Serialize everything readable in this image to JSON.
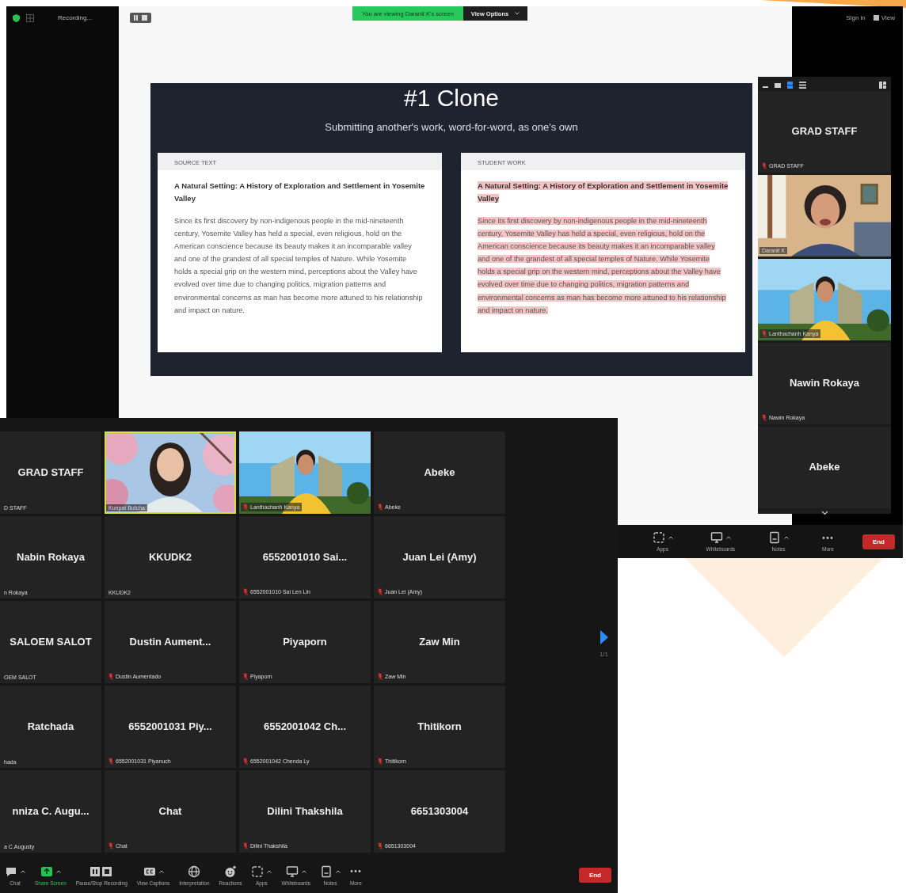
{
  "shared_screen_window": {
    "top_bar": {
      "recording": "Recording...",
      "banner": "You are viewing Daranit K's screen",
      "view_options": "View Options",
      "sign_in": "Sign in",
      "view": "View"
    },
    "slide": {
      "title": "#1 Clone",
      "subtitle": "Submitting another's work, word-for-word, as one's own",
      "panels": [
        {
          "heading": "SOURCE TEXT",
          "title": "A Natural Setting: A History of Exploration and Settlement in Yosemite Valley",
          "body": "Since its first discovery by non-indigenous people in the mid-nineteenth century, Yosemite Valley has held a special, even religious, hold on the American conscience because its beauty makes it an incomparable valley and one of the grandest of all special temples of Nature. While Yosemite holds a special grip on the western mind, perceptions about the Valley have evolved over time due to changing politics, migration patterns and environmental concerns as man has become more attuned to his relationship and impact on nature.",
          "highlighted": false
        },
        {
          "heading": "STUDENT WORK",
          "title": "A Natural Setting: A History of Exploration and Settlement in Yosemite Valley",
          "body": "Since its first discovery by non-indigenous people in the mid-nineteenth century, Yosemite Valley has held a special, even religious, hold on the American conscience because its beauty makes it an incomparable valley and one of the grandest of all special temples of Nature. While Yosemite holds a special grip on the western mind, perceptions about the Valley have evolved over time due to changing politics, migration patterns and environmental concerns as man has become more attuned to his relationship and impact on nature.",
          "highlighted": true
        }
      ]
    },
    "gallery": [
      {
        "kind": "name",
        "name": "GRAD STAFF",
        "label": "GRAD STAFF",
        "muted": true
      },
      {
        "kind": "video",
        "label": "Daranit K",
        "muted": false
      },
      {
        "kind": "video",
        "label": "Lanthachanh Kanya",
        "muted": true
      },
      {
        "kind": "name",
        "name": "Nawin Rokaya",
        "label": "Nawin Rokaya",
        "muted": true
      },
      {
        "kind": "name",
        "name": "Abeke"
      }
    ],
    "toolbar": [
      {
        "kind": "apps",
        "label": "Apps"
      },
      {
        "kind": "whiteboards",
        "label": "Whiteboards"
      },
      {
        "kind": "notes",
        "label": "Notes"
      },
      {
        "kind": "more",
        "label": "More"
      }
    ],
    "end": "End"
  },
  "meeting_window": {
    "tiles": [
      {
        "kind": "name",
        "name": "GRAD STAFF",
        "label": "D STAFF",
        "muted": false,
        "speaking": false
      },
      {
        "kind": "video",
        "label": "Kunpat Butcha",
        "muted": false,
        "speaking": true
      },
      {
        "kind": "video",
        "label": "Lanthachanh Kanya",
        "muted": true,
        "speaking": false
      },
      {
        "kind": "name",
        "name": "Abeke",
        "label": "Abeke",
        "muted": true,
        "speaking": false
      },
      {
        "kind": "name",
        "name": "Nabin Rokaya",
        "label": "n Rokaya",
        "muted": false,
        "speaking": false
      },
      {
        "kind": "name",
        "name": "KKUDK2",
        "label": "KKUDK2",
        "muted": false,
        "speaking": false
      },
      {
        "kind": "name",
        "name": "6552001010  Sai...",
        "label": "6552001010 Sai Len Lin",
        "muted": true,
        "speaking": false
      },
      {
        "kind": "name",
        "name": "Juan Lei (Amy)",
        "label": "Juan Lei (Amy)",
        "muted": true,
        "speaking": false
      },
      {
        "kind": "name",
        "name": "SALOEM SALOT",
        "label": "OEM SALOT",
        "muted": false,
        "speaking": false
      },
      {
        "kind": "name",
        "name": "Dustin  Aument...",
        "label": "Dustin Aumentado",
        "muted": true,
        "speaking": false
      },
      {
        "kind": "name",
        "name": "Piyaporn",
        "label": "Piyaporn",
        "muted": true,
        "speaking": false
      },
      {
        "kind": "name",
        "name": "Zaw Min",
        "label": "Zaw Min",
        "muted": true,
        "speaking": false
      },
      {
        "kind": "name",
        "name": "Ratchada",
        "label": "hada",
        "muted": false,
        "speaking": false
      },
      {
        "kind": "name",
        "name": "6552001031  Piy...",
        "label": "6552001031 Piyanuch",
        "muted": true,
        "speaking": false
      },
      {
        "kind": "name",
        "name": "6552001042  Ch...",
        "label": "6552001042 Chenda Ly",
        "muted": true,
        "speaking": false
      },
      {
        "kind": "name",
        "name": "Thitikorn",
        "label": "Thitikorn",
        "muted": true,
        "speaking": false
      },
      {
        "kind": "name",
        "name": "nniza C. Augu...",
        "label": "a C.Augusty",
        "muted": false,
        "speaking": false
      },
      {
        "kind": "name",
        "name": "Chat",
        "label": "Chat",
        "muted": true,
        "speaking": false
      },
      {
        "kind": "name",
        "name": "Dilini Thakshila",
        "label": "Dilini Thakshila",
        "muted": true,
        "speaking": false
      },
      {
        "kind": "name",
        "name": "6651303004",
        "label": "6651303004",
        "muted": true,
        "speaking": false
      }
    ],
    "page": "1/1",
    "toolbar": [
      {
        "kind": "chat",
        "label": "Chat"
      },
      {
        "kind": "share",
        "label": "Share Screen"
      },
      {
        "kind": "recording",
        "label": "Pause/Stop Recording"
      },
      {
        "kind": "captions",
        "label": "View Captions"
      },
      {
        "kind": "interpretation",
        "label": "Interpretation"
      },
      {
        "kind": "reactions",
        "label": "Reactions"
      },
      {
        "kind": "apps",
        "label": "Apps"
      },
      {
        "kind": "whiteboards",
        "label": "Whiteboards"
      },
      {
        "kind": "notes",
        "label": "Notes"
      },
      {
        "kind": "more",
        "label": "More"
      }
    ],
    "end": "End"
  }
}
